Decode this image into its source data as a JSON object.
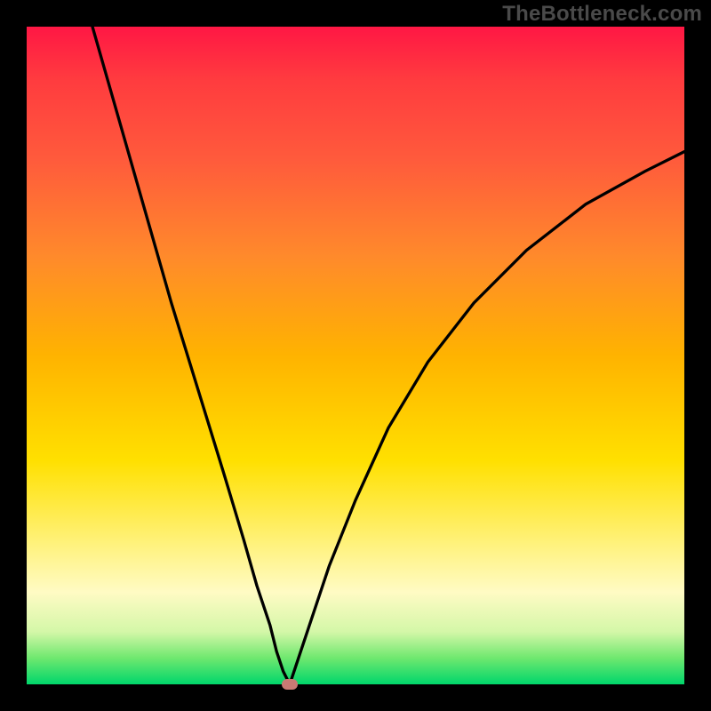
{
  "watermark": "TheBottleneck.com",
  "colors": {
    "frame": "#000000",
    "curve": "#000000",
    "marker": "#c97a74",
    "gradient_stops": [
      "#ff1744",
      "#ff3b3f",
      "#ff5a3c",
      "#ff8a2b",
      "#ffb300",
      "#ffe000",
      "#fff176",
      "#fffbc4",
      "#d4f7a8",
      "#6fe86f",
      "#00d66b"
    ]
  },
  "chart_data": {
    "type": "line",
    "title": "",
    "xlabel": "",
    "ylabel": "",
    "xlim": [
      0,
      100
    ],
    "ylim": [
      0,
      100
    ],
    "grid": false,
    "legend": false,
    "series": [
      {
        "name": "curve",
        "segments": [
          {
            "name": "left-branch",
            "x": [
              10,
              14,
              18,
              22,
              26,
              30,
              33,
              35,
              37,
              38,
              39,
              40
            ],
            "y": [
              100,
              86,
              72,
              58,
              45,
              32,
              22,
              15,
              9,
              5,
              2,
              0
            ]
          },
          {
            "name": "right-branch",
            "x": [
              40,
              41,
              43,
              46,
              50,
              55,
              61,
              68,
              76,
              85,
              94,
              100
            ],
            "y": [
              0,
              3,
              9,
              18,
              28,
              39,
              49,
              58,
              66,
              73,
              78,
              81
            ]
          }
        ]
      }
    ],
    "minimum_point": {
      "x": 40,
      "y": 0
    },
    "notes": "V-shaped bottleneck curve over a vertical heat gradient (red=high bottleneck at top, green=low at bottom). Minimum near x≈40%. No axis ticks or labels are visible; values are estimated on a 0–100 normalized scale."
  }
}
